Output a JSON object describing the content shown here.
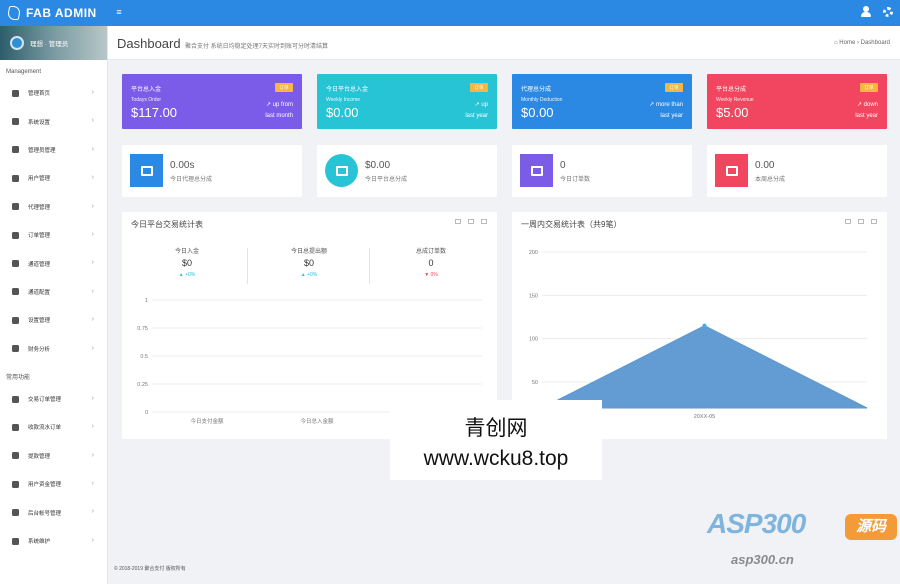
{
  "brand": {
    "title": "FAB ADMIN"
  },
  "sidebar": {
    "user": "理想 · 管理员",
    "sections": [
      {
        "label": "Management",
        "items": [
          {
            "label": "管理首页",
            "icon": "home-icon"
          },
          {
            "label": "系统设置",
            "icon": "cogs-icon"
          },
          {
            "label": "管理员管理",
            "icon": "user-circle-icon"
          },
          {
            "label": "用户管理",
            "icon": "users-icon"
          },
          {
            "label": "代理管理",
            "icon": "user-circle-icon"
          },
          {
            "label": "订单管理",
            "icon": "list-icon"
          },
          {
            "label": "通道管理",
            "icon": "lock-icon"
          },
          {
            "label": "通道配置",
            "icon": "bank-icon"
          },
          {
            "label": "设置管理",
            "icon": "edit-icon"
          },
          {
            "label": "财务分析",
            "icon": "line-chart-icon"
          }
        ]
      },
      {
        "label": "常用功能",
        "items": [
          {
            "label": "交易订单管理",
            "icon": "refresh-icon"
          },
          {
            "label": "收款流水订单",
            "icon": "card-icon"
          },
          {
            "label": "提款管理",
            "icon": "apple-icon"
          },
          {
            "label": "用户资金管理",
            "icon": "wechat-icon"
          },
          {
            "label": "后台帐号管理",
            "icon": "user-icon"
          },
          {
            "label": "系统维护",
            "icon": "cloud-icon"
          }
        ]
      }
    ]
  },
  "header": {
    "title": "Dashboard",
    "subtitle": "聚合支付 系统日均稳定处理7天实时到账可分时清结算",
    "breadcrumb_home": "Home",
    "breadcrumb_current": "Dashboard"
  },
  "kpis": [
    {
      "title": "平台总入金",
      "subtitle": "Todays Order",
      "value": "$117.00",
      "badge": "订单",
      "trend1": "up from",
      "trend2": "last month",
      "color": "#7b5ce9"
    },
    {
      "title": "今日平台总入金",
      "subtitle": "Weekly Income",
      "value": "$0.00",
      "badge": "订单",
      "trend1": "up",
      "trend2": "last year",
      "color": "#27c4d5"
    },
    {
      "title": "代理总分成",
      "subtitle": "Monthly Deduction",
      "value": "$0.00",
      "badge": "订单",
      "trend1": "more than",
      "trend2": "last year",
      "color": "#2b89e3"
    },
    {
      "title": "平台总分成",
      "subtitle": "Weekly Revenue",
      "value": "$5.00",
      "badge": "订单",
      "trend1": "down",
      "trend2": "last year",
      "color": "#f2455f"
    }
  ],
  "stats": [
    {
      "value": "0.00s",
      "label": "今日代理总分成",
      "color": "#2b89e3",
      "icon": "bar-chart-icon"
    },
    {
      "value": "$0.00",
      "label": "今日平台总分成",
      "color": "#27c4d5",
      "icon": "thumbs-up-icon"
    },
    {
      "value": "0",
      "label": "今日订单数",
      "color": "#7b5ce9",
      "icon": "shopping-bag-icon"
    },
    {
      "value": "0.00",
      "label": "本周总分成",
      "color": "#f2455f",
      "icon": "users-icon"
    }
  ],
  "panel_left": {
    "title": "今日平台交易统计表",
    "summary": [
      {
        "label": "今日入金",
        "value": "$0",
        "change": "+0%",
        "dir": "up"
      },
      {
        "label": "今日总提出额",
        "value": "$0",
        "change": "+0%",
        "dir": "up"
      },
      {
        "label": "总成订单数",
        "value": "0",
        "change": "0%",
        "dir": "down"
      }
    ]
  },
  "panel_right": {
    "title": "一周内交易统计表（共9笔）"
  },
  "chart_data": [
    {
      "type": "bar",
      "title": "今日平台交易统计表",
      "categories": [
        "今日支付金额",
        "今日总入金额",
        ""
      ],
      "values": [
        0,
        0,
        0
      ],
      "yticks": [
        0,
        0.25,
        0.5,
        0.75,
        1
      ],
      "ylim": [
        0,
        1
      ],
      "grid": true
    },
    {
      "type": "area",
      "title": "一周内交易统计表（共9笔）",
      "categories": [
        "",
        "20XX-05",
        ""
      ],
      "values": [
        0,
        115,
        0
      ],
      "yticks": [
        50,
        100,
        150,
        200
      ],
      "ylim": [
        20,
        200
      ],
      "grid": true,
      "color": "#5b97d1"
    }
  ],
  "overlay": {
    "line1": "青创网",
    "line2": "www.wcku8.top",
    "stamp_big": "ASP300",
    "stamp_badge": "源码",
    "stamp_url": "asp300.cn"
  },
  "footer": {
    "text": "© 2018-2019 聚合支付 版权所有"
  }
}
